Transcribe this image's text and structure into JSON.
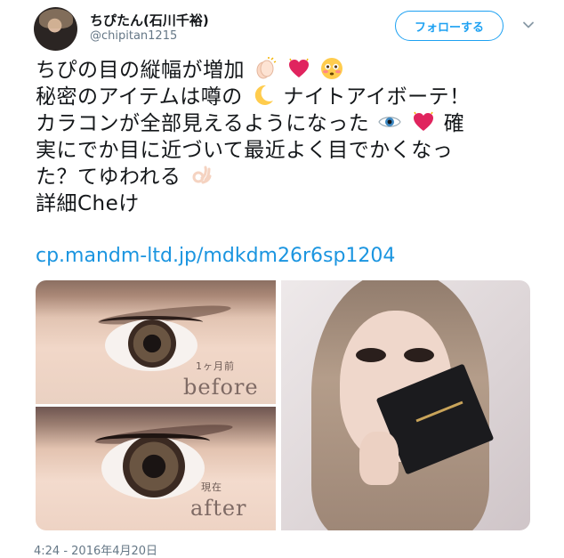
{
  "user": {
    "display_name": "ちぴたん(石川千裕)",
    "handle": "@chipitan1215"
  },
  "follow_button_label": "フォローする",
  "tweet": {
    "lines": [
      "ちぴの目の縦幅が増加",
      "秘密のアイテムは噂の",
      "ナイトアイボーテ！",
      "カラコンが全部見えるようになった",
      "確",
      "実にでか目に近づいて最近よく目でかくなっ",
      "た？てゆわれる",
      "詳細Cheけ"
    ],
    "link_text": "cp.mandm-ltd.jp/mdkdm26r6sp1204",
    "emojis": [
      "clapping-hands-icon",
      "sparkling-heart-icon",
      "flushed-face-icon",
      "crescent-moon-icon",
      "eye-icon",
      "sparkling-heart-icon",
      "ok-hand-icon"
    ]
  },
  "media": {
    "before_small_label": "1ヶ月前",
    "before_big_label": "before",
    "after_small_label": "現在",
    "after_big_label": "after"
  },
  "timestamp": "4:24 - 2016年4月20日",
  "colors": {
    "accent": "#1da1f2",
    "link": "#1b95e0",
    "text": "#14171a",
    "muted": "#657786",
    "heart": "#e0245e"
  }
}
